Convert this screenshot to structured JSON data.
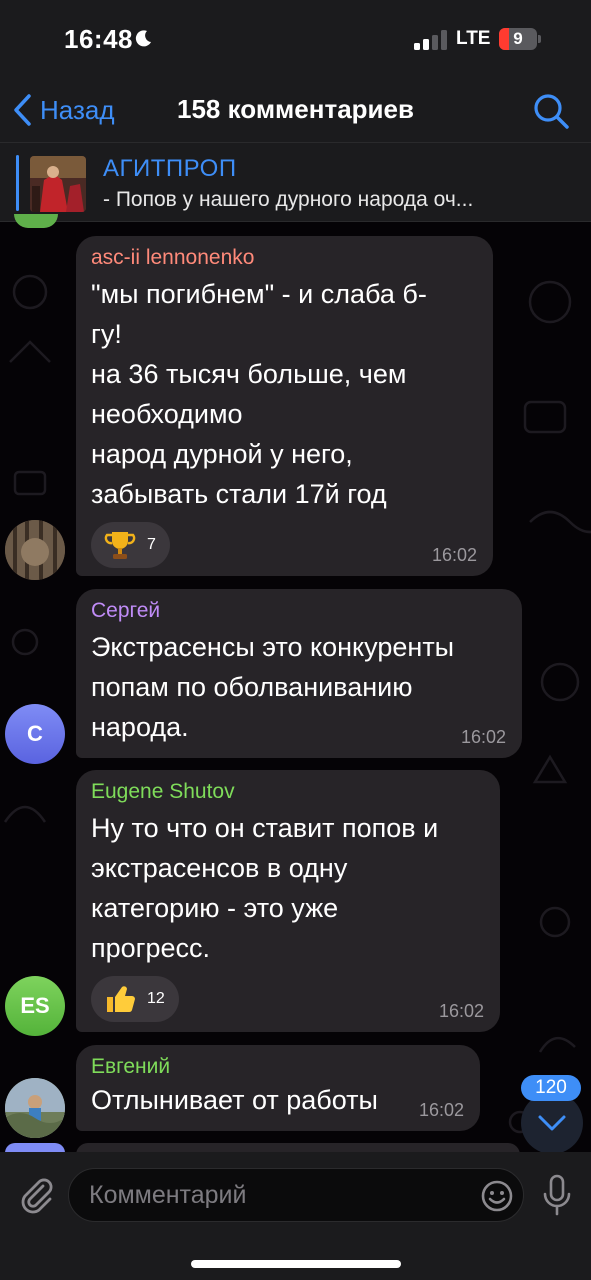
{
  "status_bar": {
    "time": "16:48",
    "network": "LTE",
    "battery": "9"
  },
  "nav": {
    "back_label": "Назад",
    "title": "158 комментариев"
  },
  "pinned_post": {
    "channel": "АГИТПРОП",
    "excerpt": "- Попов у нашего дурного народа оч..."
  },
  "messages": [
    {
      "sender": "asc-ii lennonenko",
      "sender_color": "#ff8a7a",
      "text": "\"мы погибнем\" - и слаба б-\nгу!\nна 36 тысяч больше, чем\nнеобходимо\nнарод дурной у него,\nзабывать стали 17й год",
      "reaction": {
        "emoji": "trophy-icon",
        "count": "7"
      },
      "time": "16:02"
    },
    {
      "sender": "Сергей",
      "sender_color": "#c08cf7",
      "avatar_letter": "С",
      "text": "Экстрасенсы это конкуренты\nпопам по оболваниванию\nнарода.",
      "time": "16:02"
    },
    {
      "sender": "Eugene Shutov",
      "sender_color": "#7fdc5a",
      "avatar_letter": "ES",
      "text": "Ну то что он ставит попов и\nэкстрасенсов в одну\nкатегорию - это уже\nпрогресс.",
      "reaction": {
        "emoji": "thumbs-up-icon",
        "count": "12"
      },
      "time": "16:02"
    },
    {
      "sender": "Евгений",
      "sender_color": "#7fdc5a",
      "text": "Отлынивает от работы",
      "time": "16:02"
    }
  ],
  "scroll_badge": {
    "unread_count": "120"
  },
  "composer": {
    "placeholder": "Комментарий"
  },
  "colors": {
    "accent": "#3e8ef7",
    "bubble": "#272428",
    "bar": "#1b1b1d"
  }
}
